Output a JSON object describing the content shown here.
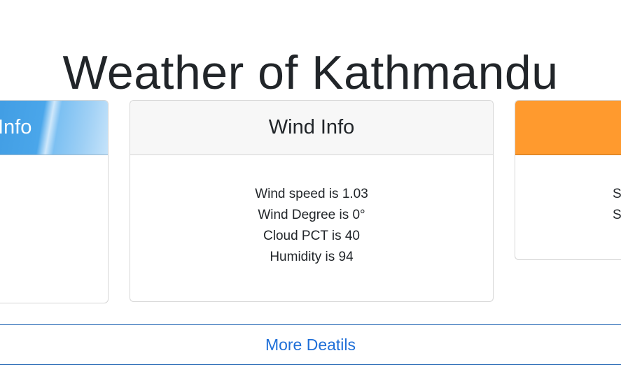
{
  "title": "Weather of Kathmandu",
  "cards": {
    "left": {
      "header": "Info",
      "lines": []
    },
    "middle": {
      "header": "Wind Info",
      "lines": [
        "Wind speed is 1.03",
        "Wind Degree is 0°",
        "Cloud PCT is 40",
        "Humidity is 94"
      ]
    },
    "right": {
      "header": "",
      "lines": [
        "Su",
        "S"
      ]
    }
  },
  "more_details_label": "More Deatils",
  "colors": {
    "link": "#1f6fd8",
    "right_header": "#ff9a2e",
    "left_header": "#4aa6ea",
    "divider": "#2f6fb8"
  }
}
